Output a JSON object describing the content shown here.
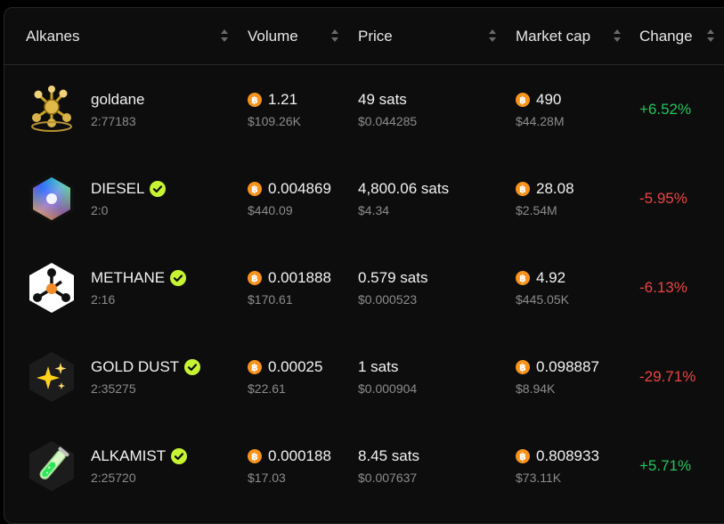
{
  "columns": {
    "alkanes": "Alkanes",
    "volume": "Volume",
    "price": "Price",
    "market_cap": "Market cap",
    "change": "Change"
  },
  "colors": {
    "positive": "#22c55e",
    "negative": "#ef4444",
    "bitcoin": "#f7931a",
    "verified": "#c6f432"
  },
  "rows": [
    {
      "name": "goldane",
      "id": "2:77183",
      "verified": false,
      "logo_icon": "gold-molecule-icon",
      "volume_btc": "1.21",
      "volume_usd": "$109.26K",
      "price_sats": "49 sats",
      "price_usd": "$0.044285",
      "mcap_btc": "490",
      "mcap_usd": "$44.28M",
      "change": "+6.52%",
      "direction": "up"
    },
    {
      "name": "DIESEL",
      "id": "2:0",
      "verified": true,
      "logo_icon": "diesel-prism-icon",
      "volume_btc": "0.004869",
      "volume_usd": "$440.09",
      "price_sats": "4,800.06 sats",
      "price_usd": "$4.34",
      "mcap_btc": "28.08",
      "mcap_usd": "$2.54M",
      "change": "-5.95%",
      "direction": "down"
    },
    {
      "name": "METHANE",
      "id": "2:16",
      "verified": true,
      "logo_icon": "methane-molecule-icon",
      "volume_btc": "0.001888",
      "volume_usd": "$170.61",
      "price_sats": "0.579 sats",
      "price_usd": "$0.000523",
      "mcap_btc": "4.92",
      "mcap_usd": "$445.05K",
      "change": "-6.13%",
      "direction": "down"
    },
    {
      "name": "GOLD DUST",
      "id": "2:35275",
      "verified": true,
      "logo_icon": "sparkles-icon",
      "volume_btc": "0.00025",
      "volume_usd": "$22.61",
      "price_sats": "1 sats",
      "price_usd": "$0.000904",
      "mcap_btc": "0.098887",
      "mcap_usd": "$8.94K",
      "change": "-29.71%",
      "direction": "down"
    },
    {
      "name": "ALKAMIST",
      "id": "2:25720",
      "verified": true,
      "logo_icon": "test-tube-icon",
      "volume_btc": "0.000188",
      "volume_usd": "$17.03",
      "price_sats": "8.45 sats",
      "price_usd": "$0.007637",
      "mcap_btc": "0.808933",
      "mcap_usd": "$73.11K",
      "change": "+5.71%",
      "direction": "up"
    }
  ]
}
